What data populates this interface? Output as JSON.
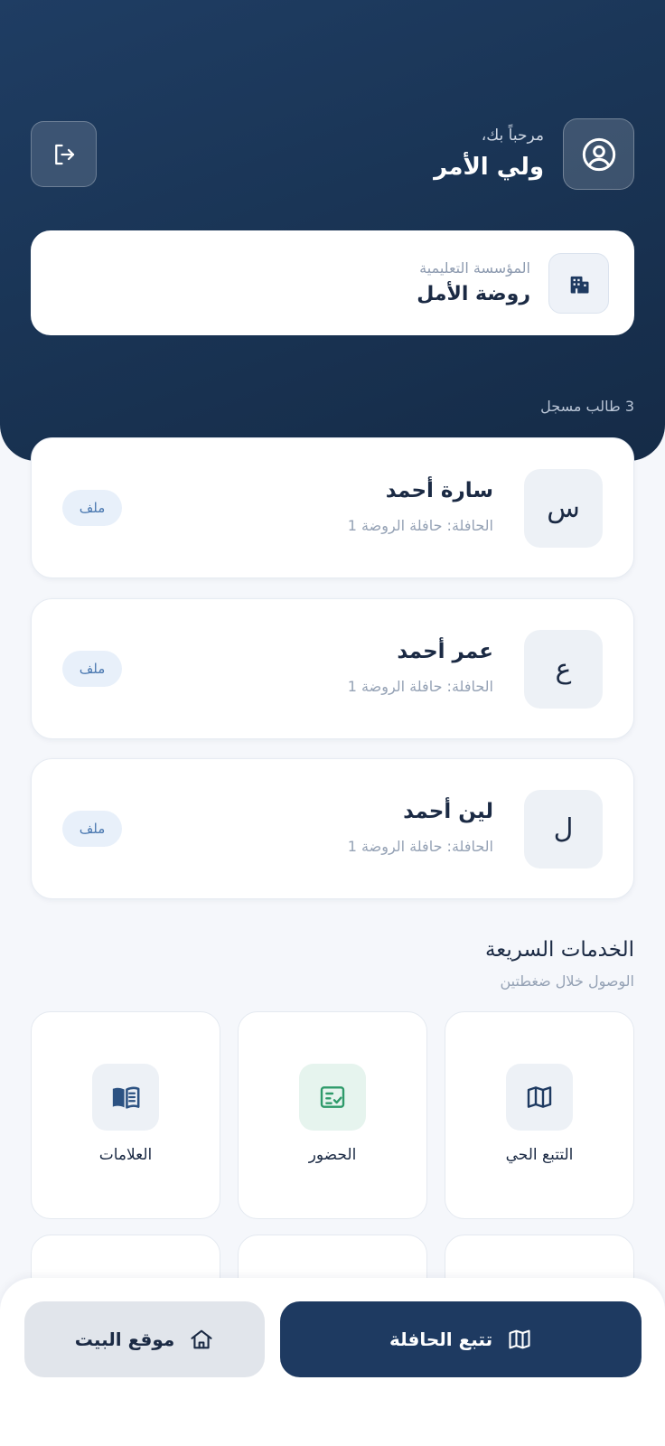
{
  "header": {
    "welcome": "مرحباً بك،",
    "role": "ولي الأمر",
    "avatar_icon": "user-circle-icon",
    "logout_icon": "logout-icon"
  },
  "institution": {
    "label": "المؤسسة التعليمية",
    "name": "روضة الأمل",
    "icon": "building-icon"
  },
  "students_count": "3 طالب مسجل",
  "students": [
    {
      "initial": "س",
      "name": "سارة أحمد",
      "bus": "الحافلة: حافلة الروضة 1",
      "action": "ملف"
    },
    {
      "initial": "ع",
      "name": "عمر أحمد",
      "bus": "الحافلة: حافلة الروضة 1",
      "action": "ملف"
    },
    {
      "initial": "ل",
      "name": "لين أحمد",
      "bus": "الحافلة: حافلة الروضة 1",
      "action": "ملف"
    }
  ],
  "quick_services": {
    "title": "الخدمات السريعة",
    "subtitle": "الوصول خلال ضغطتين",
    "items": [
      {
        "label": "التتبع الحي",
        "icon": "map-icon",
        "bg": "#edf1f6",
        "color": "#1e3a61"
      },
      {
        "label": "الحضور",
        "icon": "attendance-checklist-icon",
        "bg": "#e6f4ee",
        "color": "#2e9a6a"
      },
      {
        "label": "العلامات",
        "icon": "book-icon",
        "bg": "#edf1f6",
        "color": "#2c5282"
      }
    ]
  },
  "bottom_actions": {
    "track_bus": "تتبع الحافلة",
    "home_location": "موقع البيت"
  },
  "colors": {
    "primary": "#1e3a61",
    "accent_green": "#2e9a6a",
    "background": "#f5f7fb"
  }
}
